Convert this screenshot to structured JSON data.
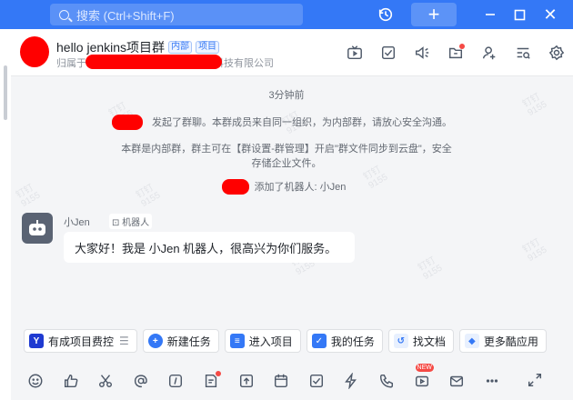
{
  "search": {
    "placeholder": "搜索 (Ctrl+Shift+F)"
  },
  "window": {
    "plus": "+",
    "close": "✕"
  },
  "header": {
    "title": "hello jenkins项目群",
    "tags": [
      "内部",
      "项目"
    ],
    "subtitle_prefix": "归属于",
    "subtitle_suffix": "科技有限公司",
    "icons": [
      "live-icon",
      "task-check-icon",
      "announcement-icon",
      "file-box-icon",
      "add-member-icon",
      "search-history-icon",
      "settings-icon"
    ]
  },
  "chat": {
    "time": "3分钟前",
    "sys1": "发起了群聊。本群成员来自同一组织，为内部群，请放心安全沟通。",
    "sys2_line1": "本群是内部群，群主可在【群设置-群管理】开启\"群文件同步到云盘\"，安全",
    "sys2_line2": "存储企业文件。",
    "sys3": "添加了机器人: 小Jen",
    "bot_name": "小Jen",
    "bot_tag": "机器人",
    "bot_message": "大家好！我是 小Jen 机器人，很高兴为你们服务。",
    "watermarks": [
      "钉钉",
      "9155"
    ]
  },
  "shortcuts": [
    {
      "label": "有成项目费控",
      "color": "#1f3ad1",
      "glyph": "Y"
    },
    {
      "label": "新建任务",
      "color": "#3478f6",
      "glyph": "+"
    },
    {
      "label": "进入项目",
      "color": "#3478f6",
      "glyph": "≡"
    },
    {
      "label": "我的任务",
      "color": "#3478f6",
      "glyph": "✓"
    },
    {
      "label": "找文档",
      "color": "#3478f6",
      "glyph": "↺"
    },
    {
      "label": "更多酷应用",
      "color": "#3478f6",
      "glyph": "◆"
    }
  ],
  "toolbar": {
    "new_badge": "NEW"
  }
}
